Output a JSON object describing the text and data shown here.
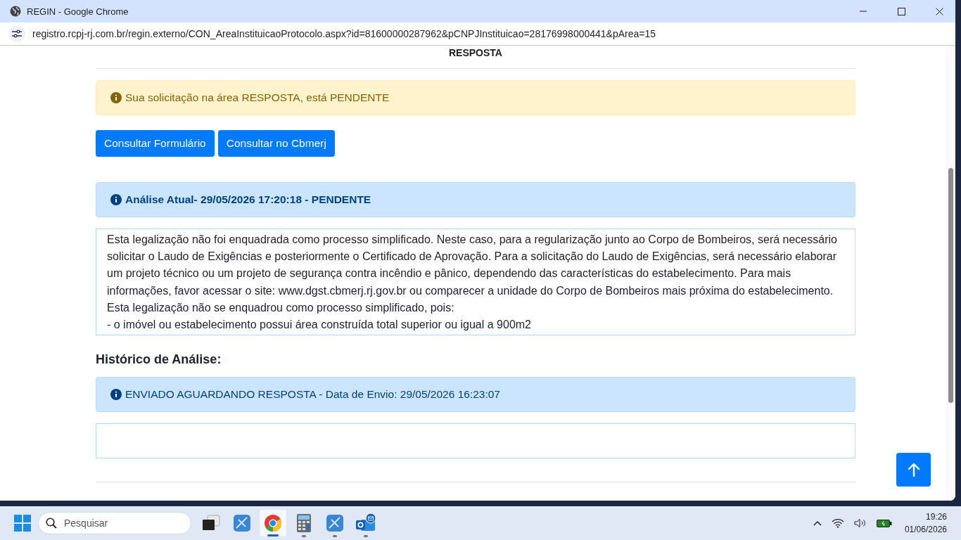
{
  "window": {
    "title": "REGIN - Google Chrome",
    "url": "registro.rcpj-rj.com.br/regin.externo/CON_AreaInstituicaoProtocolo.aspx?id=81600000287962&pCNPJInstituicao=28176998000441&pArea=15"
  },
  "page": {
    "heading": "RESPOSTA",
    "status_alert": "Sua solicitação na área RESPOSTA, está PENDENTE",
    "buttons": [
      "Consultar Formulário",
      "Consultar no Cbmerj"
    ],
    "current_analysis": {
      "title": "Análise Atual- 29/05/2026 17:20:18 - PENDENTE",
      "text": "Esta legalização não foi enquadrada como processo simplificado. Neste caso, para a regularização junto ao Corpo de Bombeiros, será necessário solicitar o Laudo de Exigências e posteriormente o Certificado de Aprovação. Para a solicitação do Laudo de Exigências, será necessário elaborar um projeto técnico ou um projeto de segurança contra incêndio e pânico, dependendo das características do estabelecimento. Para mais informações, favor acessar o site: www.dgst.cbmerj.rj.gov.br ou comparecer a unidade do Corpo de Bombeiros mais próxima do estabelecimento. Esta legalização não se enquadrou como processo simplificado, pois:",
      "list_item": "- o imóvel ou estabelecimento possui área construída total superior ou igual a 900m2"
    },
    "history_heading": "Histórico de Análise:",
    "history": [
      {
        "text": "ENVIADO AGUARDANDO RESPOSTA - Data de Envio: 29/05/2026 16:23:07"
      }
    ]
  },
  "taskbar": {
    "search_placeholder": "Pesquisar",
    "apps": [
      {
        "kind": "task-view",
        "running": false,
        "selected": false
      },
      {
        "kind": "remote",
        "running": false,
        "selected": false
      },
      {
        "kind": "chrome",
        "running": true,
        "selected": true
      },
      {
        "kind": "calculator",
        "running": true,
        "selected": false
      },
      {
        "kind": "remote",
        "running": true,
        "selected": false
      },
      {
        "kind": "mail",
        "running": true,
        "selected": false
      }
    ],
    "time": "19:26",
    "date": "01/06/2026"
  }
}
